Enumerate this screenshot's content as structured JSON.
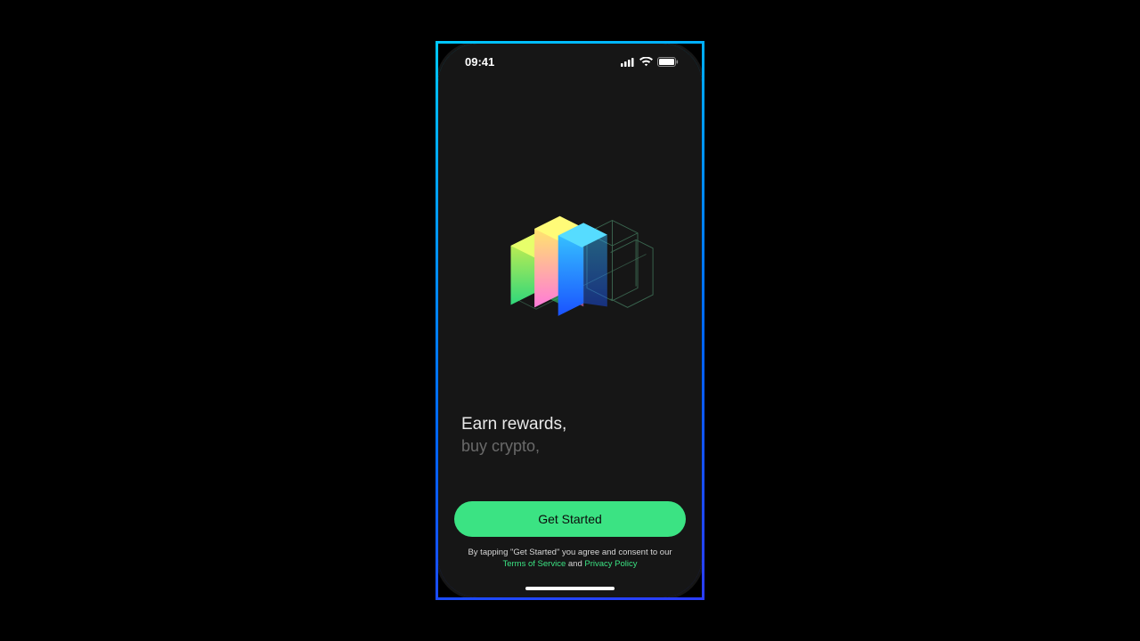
{
  "statusbar": {
    "time": "09:41"
  },
  "tagline": {
    "primary": "Earn rewards,",
    "secondary": "buy crypto,"
  },
  "cta": {
    "label": "Get Started"
  },
  "legal": {
    "prefix": "By tapping \"Get Started\" you agree and consent to our",
    "tos": "Terms of Service",
    "and": " and ",
    "privacy": "Privacy Policy"
  },
  "colors": {
    "accent": "#3be383",
    "frameGradientStart": "#00c7ff",
    "frameGradientEnd": "#2b3dff",
    "background": "#161616"
  }
}
